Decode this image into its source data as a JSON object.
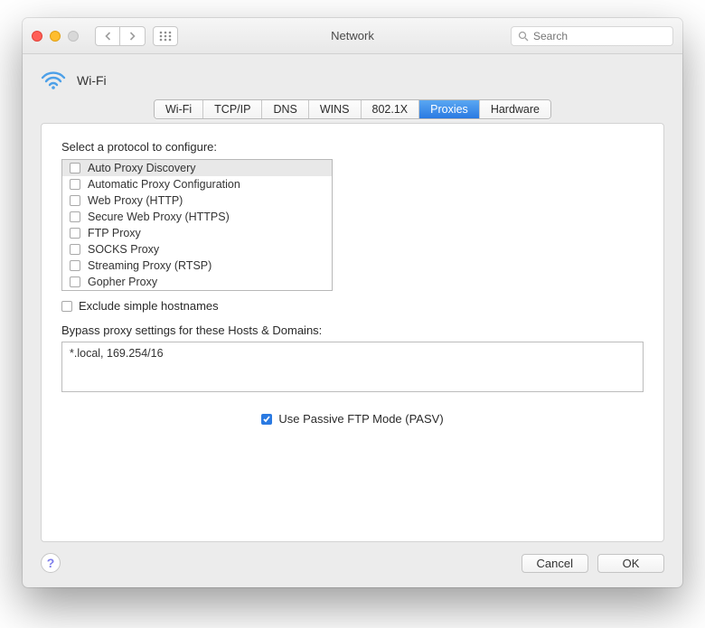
{
  "window": {
    "title": "Network"
  },
  "search": {
    "placeholder": "Search"
  },
  "header": {
    "connection_label": "Wi-Fi"
  },
  "tabs": {
    "items": [
      "Wi-Fi",
      "TCP/IP",
      "DNS",
      "WINS",
      "802.1X",
      "Proxies",
      "Hardware"
    ],
    "active_index": 5
  },
  "protocols": {
    "section_label": "Select a protocol to configure:",
    "items": [
      {
        "label": "Auto Proxy Discovery",
        "checked": false,
        "selected": true
      },
      {
        "label": "Automatic Proxy Configuration",
        "checked": false,
        "selected": false
      },
      {
        "label": "Web Proxy (HTTP)",
        "checked": false,
        "selected": false
      },
      {
        "label": "Secure Web Proxy (HTTPS)",
        "checked": false,
        "selected": false
      },
      {
        "label": "FTP Proxy",
        "checked": false,
        "selected": false
      },
      {
        "label": "SOCKS Proxy",
        "checked": false,
        "selected": false
      },
      {
        "label": "Streaming Proxy (RTSP)",
        "checked": false,
        "selected": false
      },
      {
        "label": "Gopher Proxy",
        "checked": false,
        "selected": false
      }
    ]
  },
  "exclude": {
    "checked": false,
    "label": "Exclude simple hostnames"
  },
  "bypass": {
    "label": "Bypass proxy settings for these Hosts & Domains:",
    "value": "*.local, 169.254/16"
  },
  "pasv": {
    "checked": true,
    "label": "Use Passive FTP Mode (PASV)"
  },
  "buttons": {
    "cancel": "Cancel",
    "ok": "OK"
  }
}
